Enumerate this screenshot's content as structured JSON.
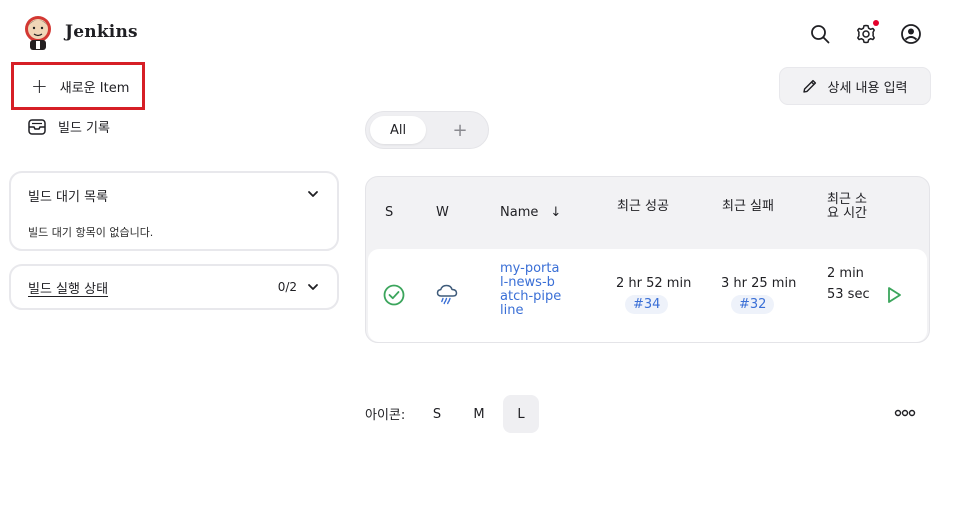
{
  "header": {
    "title": "Jenkins",
    "icons": [
      "jenkins-logo-icon",
      "search-icon",
      "gear-icon",
      "user-icon"
    ],
    "notification_color": "#e4002b"
  },
  "sidebar": {
    "new_item_label": "새로운 Item",
    "build_history_label": "빌드 기록",
    "queue": {
      "title": "빌드 대기 목록",
      "empty_text": "빌드 대기 항목이 없습니다."
    },
    "executors": {
      "title": "빌드 실행 상태",
      "count": "0/2"
    }
  },
  "main": {
    "edit_description_label": "상세 내용 입력",
    "tabs": [
      {
        "label": "All",
        "active": true
      },
      {
        "label": "+"
      }
    ],
    "table": {
      "headers": {
        "status": "S",
        "weather": "W",
        "name": "Name",
        "sort_indicator": "↓",
        "last_success": "최근 성공",
        "last_failure": "최근 실패",
        "last_duration": "최근 소요 시간"
      },
      "rows": [
        {
          "status": "success",
          "weather": "rain",
          "name": "my-portal-news-batch-pipeline",
          "last_success": "2 hr 52 min",
          "last_success_build": "#34",
          "last_failure": "3 hr 25 min",
          "last_failure_build": "#32",
          "duration": "2 min 53 sec"
        }
      ]
    },
    "icon_size": {
      "label": "아이콘:",
      "options": [
        "S",
        "M",
        "L"
      ],
      "selected": "L"
    }
  },
  "colors": {
    "success": "#3ba55c",
    "link": "#3a6fd6",
    "highlight_border": "#d61f26"
  }
}
